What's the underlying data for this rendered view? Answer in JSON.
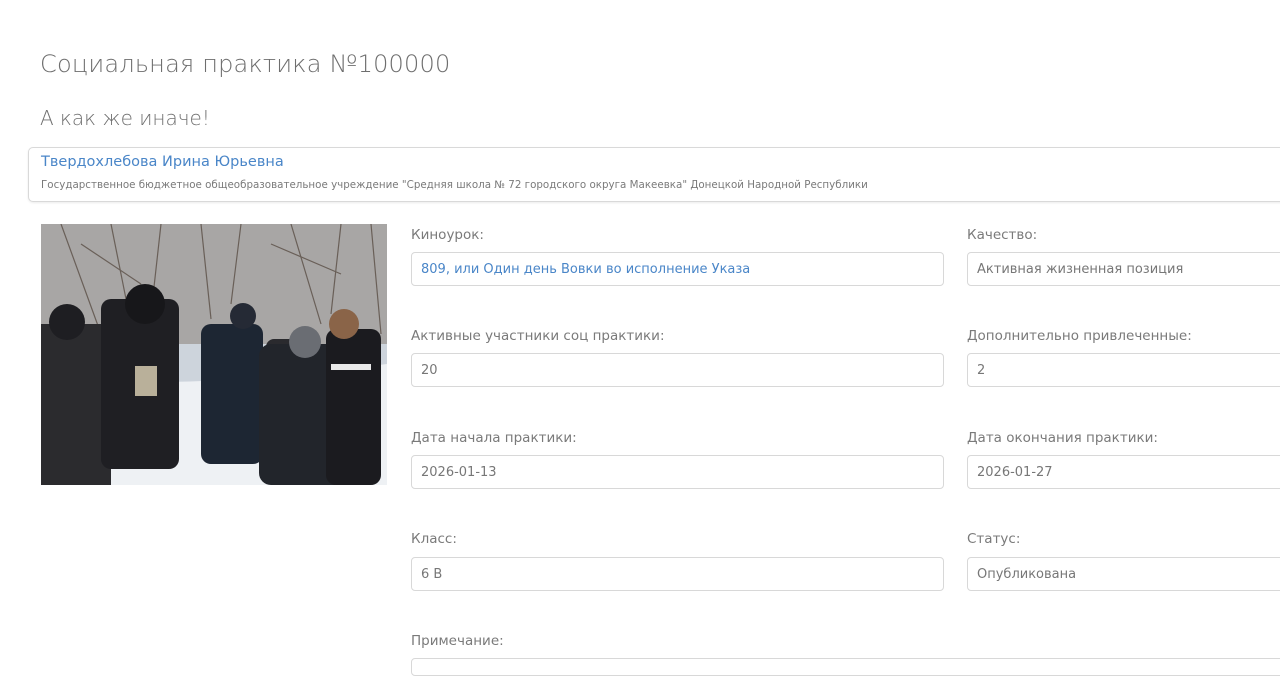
{
  "page": {
    "title": "Социальная практика №100000",
    "subtitle": "А как же иначе!"
  },
  "author": {
    "name": "Твердохлебова Ирина Юрьевна",
    "organization": "Государственное бюджетное общеобразовательное учреждение \"Средняя школа № 72 городского округа Макеевка\" Донецкой Народной Республики"
  },
  "fields": {
    "lesson": {
      "label": "Киноурок:",
      "value": "809, или Один день Вовки во исполнение Указа"
    },
    "quality": {
      "label": "Качество:",
      "value": "Активная жизненная позиция"
    },
    "active_participants": {
      "label": "Активные участники соц практики:",
      "value": "20"
    },
    "additional": {
      "label": "Дополнительно привлеченные:",
      "value": "2"
    },
    "start_date": {
      "label": "Дата начала практики:",
      "value": "2026-01-13"
    },
    "end_date": {
      "label": "Дата окончания практики:",
      "value": "2026-01-27"
    },
    "class": {
      "label": "Класс:",
      "value": "6 В"
    },
    "status": {
      "label": "Статус:",
      "value": "Опубликована"
    },
    "note": {
      "label": "Примечание:",
      "value": ""
    }
  },
  "colors": {
    "link": "#4a86c8",
    "border": "#d8d8d8",
    "text": "#777777"
  }
}
